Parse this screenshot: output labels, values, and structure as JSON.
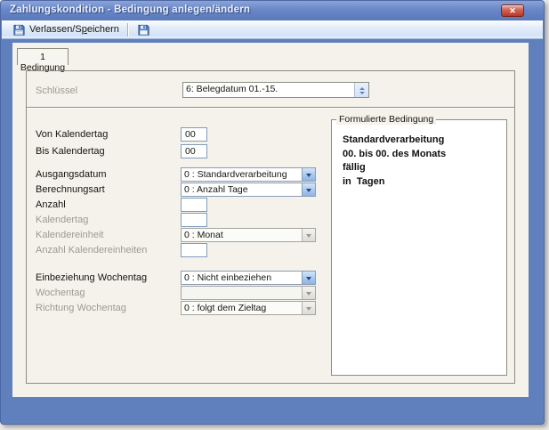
{
  "window": {
    "title": "Zahlungskondition - Bedingung anlegen/ändern",
    "close_icon": "✕"
  },
  "toolbar": {
    "exit_save_button": {
      "label_pre": "Verlassen/S",
      "label_accel": "p",
      "label_post": "eichern"
    }
  },
  "icons": {
    "exit_save": "floppy-disk-icon",
    "save": "floppy-disk-icon",
    "schluessel_spinner": "up-down-spinner-icon",
    "combo_arrow": "chevron-down-icon"
  },
  "tabs": [
    {
      "label": "1 Bedingung"
    }
  ],
  "form": {
    "schluessel": {
      "label": "Schlüssel",
      "value": "6: Belegdatum 01.-15."
    },
    "rows": [
      {
        "label": "Von Kalendertag",
        "value": "00",
        "control": "text",
        "enabled": true
      },
      {
        "label": "Bis Kalendertag",
        "value": "00",
        "control": "text",
        "enabled": true
      },
      {
        "label": "Ausgangsdatum",
        "value": "0 : Standardverarbeitung",
        "control": "combo",
        "enabled": true
      },
      {
        "label": "Berechnungsart",
        "value": "0 : Anzahl Tage",
        "control": "combo",
        "enabled": true
      },
      {
        "label": "Anzahl",
        "value": "",
        "control": "text",
        "enabled": true
      },
      {
        "label": "Kalendertag",
        "value": "",
        "control": "text",
        "enabled": false
      },
      {
        "label": "Kalendereinheit",
        "value": "0 : Monat",
        "control": "combo",
        "enabled": false
      },
      {
        "label": "Anzahl Kalendereinheiten",
        "value": "",
        "control": "text",
        "enabled": false
      },
      {
        "label": "Einbeziehung Wochentag",
        "value": "0 : Nicht einbeziehen",
        "control": "combo",
        "enabled": true
      },
      {
        "label": "Wochentag",
        "value": "",
        "control": "combo",
        "enabled": false
      },
      {
        "label": "Richtung Wochentag",
        "value": "0 : folgt dem Zieltag",
        "control": "combo",
        "enabled": false
      }
    ]
  },
  "result_panel": {
    "title": "Formulierte Bedingung",
    "lines": [
      "Standardverarbeitung",
      "00. bis 00. des Monats",
      "fällig",
      "in  Tagen"
    ]
  },
  "colors": {
    "frame_blue": "#6080bd",
    "titlebar_gradient_top": "#8ba3d8",
    "titlebar_gradient_bottom": "#5a7abc",
    "close_button_red": "#bb3a28",
    "client_beige": "#f4f2eb",
    "combo_button_blue": "#a9c8ee",
    "toolbar_blue": "#d3e2f5"
  }
}
